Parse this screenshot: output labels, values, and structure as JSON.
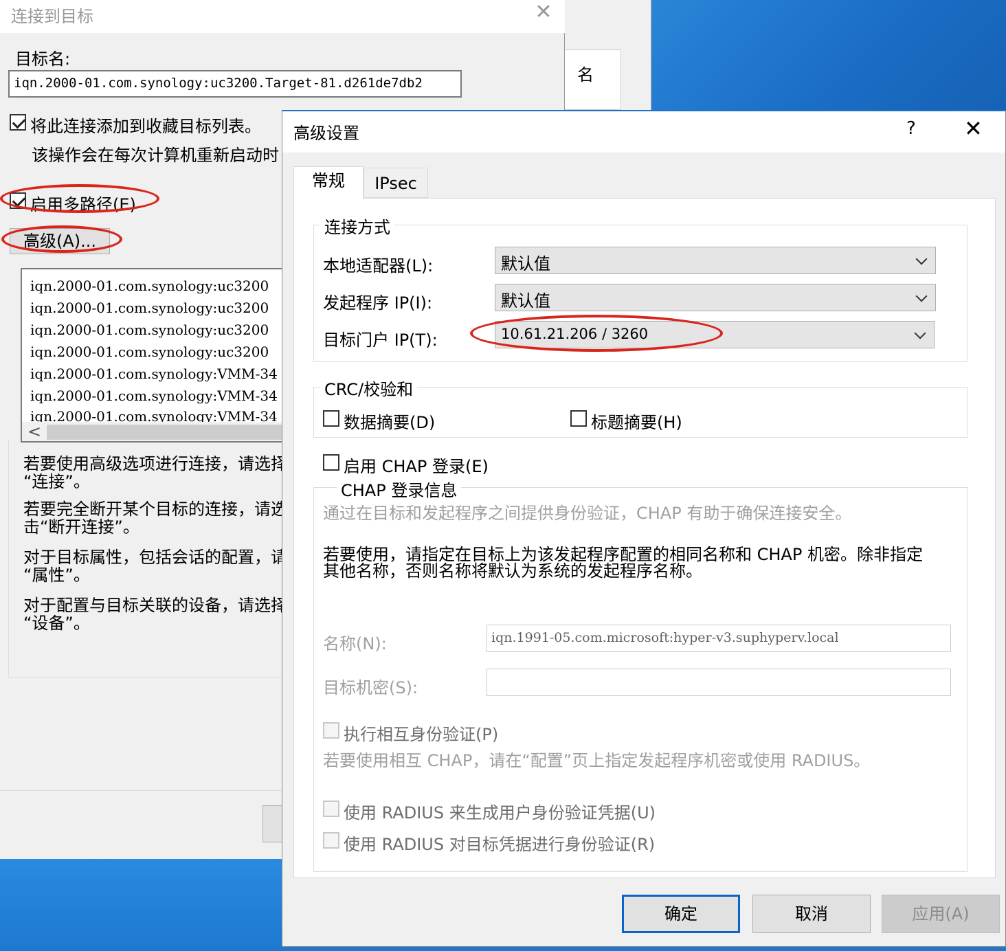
{
  "connect_dialog": {
    "title": "连接到目标",
    "close_glyph": "✕",
    "target_label": "目标名:",
    "target_value": "iqn.2000-01.com.synology:uc3200.Target-81.d261de7db2",
    "add_favorites_label": "将此连接添加到收藏目标列表。",
    "add_favorites_desc": "该操作会在每次计算机重新启动时",
    "multipath_label": "启用多路径(E)",
    "advanced_button": "高级(A)...",
    "targets": [
      "iqn.2000-01.com.synology:uc3200",
      "iqn.2000-01.com.synology:uc3200",
      "iqn.2000-01.com.synology:uc3200",
      "iqn.2000-01.com.synology:uc3200",
      "iqn.2000-01.com.synology:VMM-34",
      "iqn.2000-01.com.synology:VMM-34",
      "iqn.2000-01.com.synology:VMM-34"
    ],
    "scroll_left_glyph": "<",
    "help_lines": [
      "若要使用高级选项进行连接，请选择",
      "“连接”。",
      "若要完全断开某个目标的连接，请选",
      "击“断开连接”。",
      "对于目标属性，包括会话的配置，请",
      "“属性”。",
      "对于配置与目标关联的设备，请选择",
      "“设备”。"
    ]
  },
  "background_window": {
    "column_header": "名"
  },
  "advanced_dialog": {
    "title": "高级设置",
    "help_glyph": "?",
    "close_glyph": "✕",
    "tabs": [
      "常规",
      "IPsec"
    ],
    "connect_group": {
      "legend": "连接方式",
      "local_adapter_label": "本地适配器(L):",
      "local_adapter_value": "默认值",
      "initiator_ip_label": "发起程序 IP(I):",
      "initiator_ip_value": "默认值",
      "target_portal_label": "目标门户 IP(T):",
      "target_portal_value": "10.61.21.206 / 3260"
    },
    "crc_group": {
      "legend": "CRC/校验和",
      "data_digest": "数据摘要(D)",
      "header_digest": "标题摘要(H)"
    },
    "chap": {
      "enable_label": "启用 CHAP 登录(E)",
      "legend": "CHAP 登录信息",
      "desc1": "通过在目标和发起程序之间提供身份验证，CHAP 有助于确保连接安全。",
      "desc2_line1": "若要使用，请指定在目标上为该发起程序配置的相同名称和 CHAP 机密。除非指定",
      "desc2_line2": "其他名称，否则名称将默认为系统的发起程序名称。",
      "name_label": "名称(N):",
      "name_value": "iqn.1991-05.com.microsoft:hyper-v3.suphyperv.local",
      "secret_label": "目标机密(S):",
      "secret_value": "",
      "mutual_label": "执行相互身份验证(P)",
      "mutual_desc": "若要使用相互 CHAP，请在“配置”页上指定发起程序机密或使用 RADIUS。",
      "radius_gen_label": "使用 RADIUS 来生成用户身份验证凭据(U)",
      "radius_auth_label": "使用 RADIUS 对目标凭据进行身份验证(R)"
    },
    "buttons": {
      "ok": "确定",
      "cancel": "取消",
      "apply": "应用(A)"
    }
  },
  "colors": {
    "annotation_red": "#d9261c",
    "desktop_blue": "#1e73c8",
    "dialog_bg": "#f0f0f0"
  }
}
